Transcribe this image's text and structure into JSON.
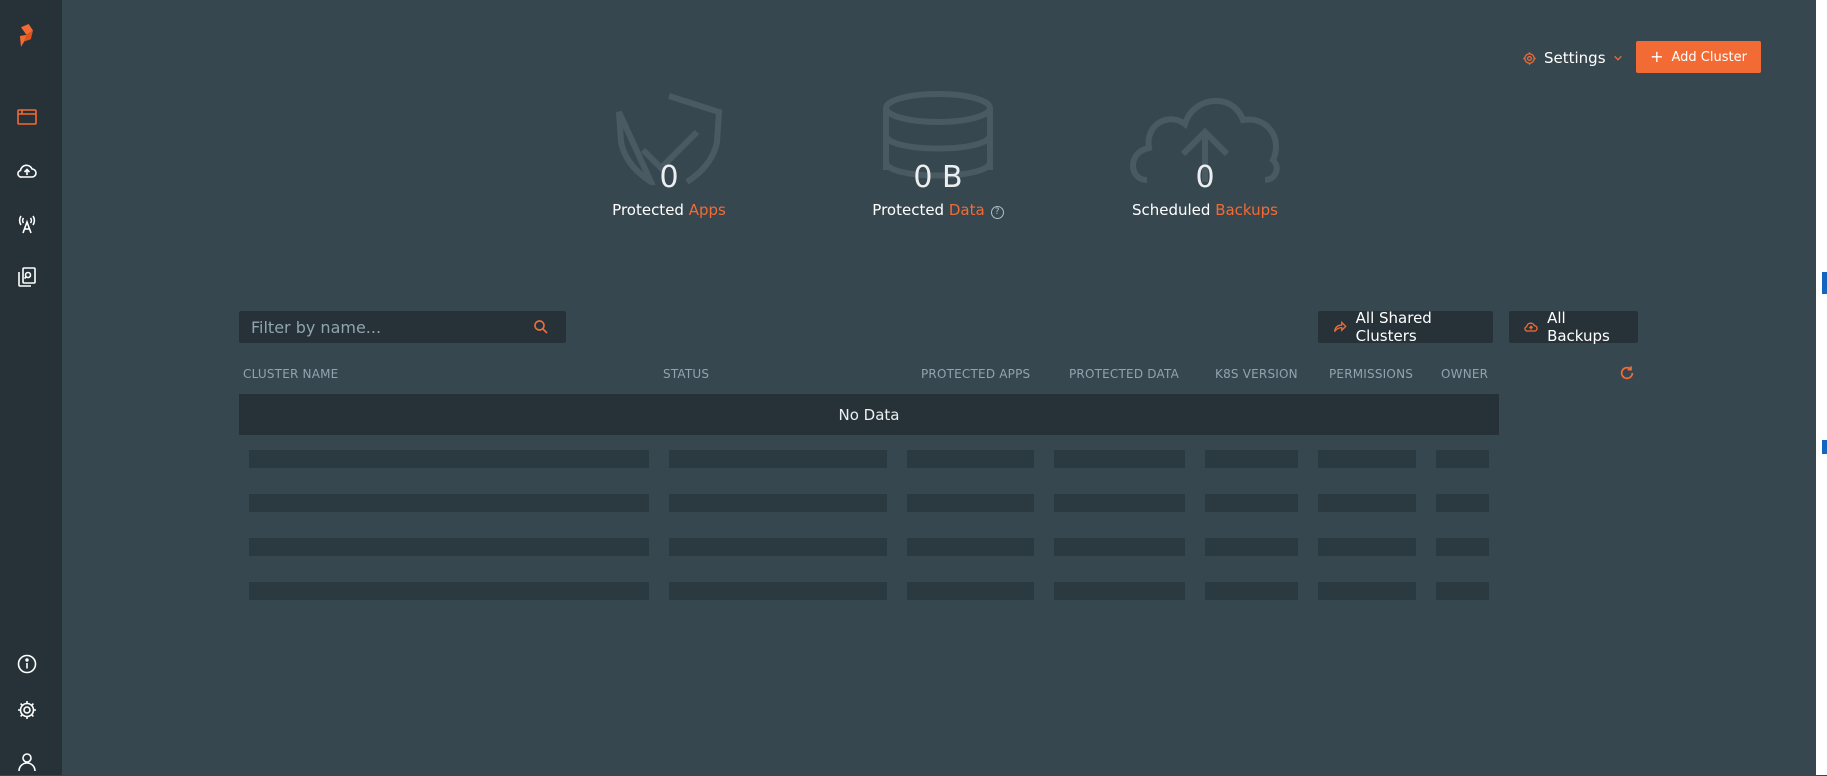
{
  "sidebar": {
    "logo": "portworx-logo",
    "items": [
      {
        "icon": "clusters-icon",
        "active": true
      },
      {
        "icon": "cloud-upload-icon",
        "active": false
      },
      {
        "icon": "antenna-icon",
        "active": false
      },
      {
        "icon": "documents-icon",
        "active": false
      }
    ],
    "bottom": [
      {
        "icon": "info-icon"
      },
      {
        "icon": "gear-icon"
      },
      {
        "icon": "user-icon"
      }
    ]
  },
  "header": {
    "settings_label": "Settings",
    "add_cluster_label": "Add Cluster"
  },
  "stats": {
    "apps": {
      "value": "0",
      "label": "Protected ",
      "accent": "Apps"
    },
    "data": {
      "value": "0 B",
      "label": "Protected ",
      "accent": "Data",
      "help": "?"
    },
    "backups": {
      "value": "0",
      "label": "Scheduled ",
      "accent": "Backups"
    }
  },
  "toolbar": {
    "filter_placeholder": "Filter by name...",
    "shared_clusters_label": "All Shared Clusters",
    "all_backups_label": "All Backups"
  },
  "table": {
    "columns": [
      "CLUSTER NAME",
      "STATUS",
      "PROTECTED APPS",
      "PROTECTED DATA",
      "K8S VERSION",
      "PERMISSIONS",
      "OWNER"
    ],
    "empty_text": "No Data"
  },
  "colors": {
    "accent": "#f26b35",
    "sidebar": "#263238",
    "background": "#37474f"
  }
}
